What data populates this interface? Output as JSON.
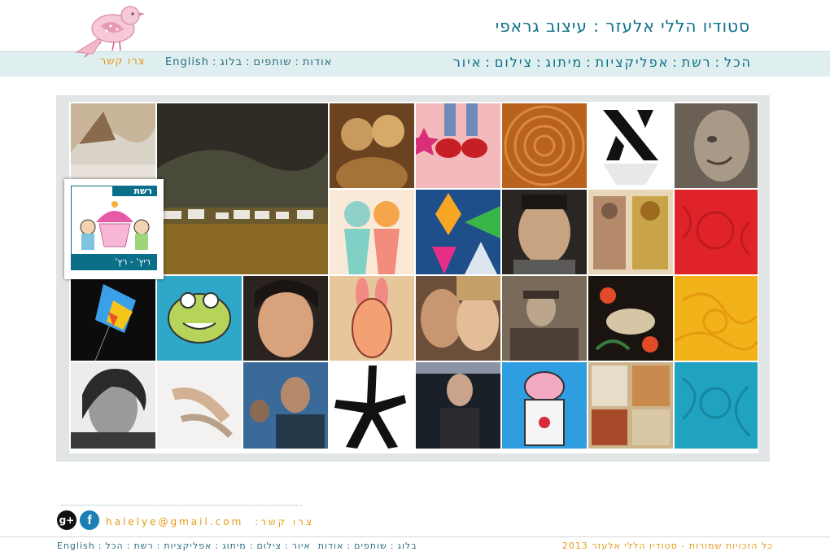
{
  "header": {
    "site_title": "סטודיו הללי אלעזר : עיצוב גראפי",
    "main_nav": [
      "הכל",
      "רשת",
      "אפליקציות",
      "מיתוג",
      "צילום",
      "איור"
    ],
    "secondary_nav": [
      "English",
      "אודות",
      "שותפים",
      "בלוג"
    ],
    "contact_link": "צרו קשר",
    "separator": ":"
  },
  "gallery": {
    "featured": {
      "category_label": "רשת",
      "title": "ריץ' - רץ'"
    }
  },
  "footer": {
    "contact_label": "צרו קשר:",
    "email": "halelye@gmail.com",
    "copyright": "כל הזכויות שמורות - סטודיו הללי אלעזר 2013",
    "nav": [
      "English",
      "בלוג",
      "שותפים",
      "אודות",
      "איור",
      "צילום",
      "מיתוג",
      "אפליקציות",
      "רשת",
      "הכל"
    ],
    "social": {
      "gplus_glyph": "g+",
      "facebook_glyph": "f"
    }
  },
  "colors": {
    "accent_teal": "#0b6f8a",
    "accent_orange": "#e59b16",
    "nav_band": "#dfeeee"
  }
}
